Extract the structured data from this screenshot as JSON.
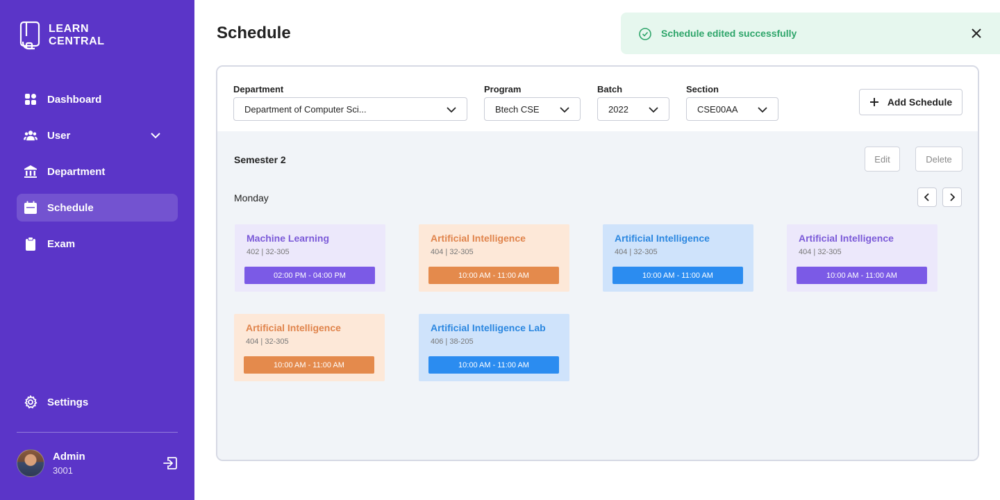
{
  "app": {
    "logo_line1": "LEARN",
    "logo_line2": "CENTRAL"
  },
  "sidebar": {
    "items": [
      {
        "label": "Dashboard",
        "icon": "grid-icon"
      },
      {
        "label": "User",
        "icon": "users-icon"
      },
      {
        "label": "Department",
        "icon": "bank-icon"
      },
      {
        "label": "Schedule",
        "icon": "calendar-icon",
        "active": true
      },
      {
        "label": "Exam",
        "icon": "clipboard-icon"
      }
    ],
    "settings_label": "Settings",
    "user_name": "Admin",
    "user_id": "3001"
  },
  "page": {
    "title": "Schedule"
  },
  "toast": {
    "message": "Schedule edited successfully"
  },
  "filters": {
    "department_label": "Department",
    "department_value": "Department of Computer Sci...",
    "program_label": "Program",
    "program_value": "Btech CSE",
    "batch_label": "Batch",
    "batch_value": "2022",
    "section_label": "Section",
    "section_value": "CSE00AA",
    "add_label": "Add Schedule"
  },
  "semester": {
    "label": "Semester 2",
    "edit_label": "Edit",
    "delete_label": "Delete",
    "day": "Monday"
  },
  "schedules": [
    {
      "title": "Machine Learning",
      "meta": "402 | 32-305",
      "time": "02:00 PM - 04:00 PM",
      "color": "purple"
    },
    {
      "title": "Artificial Intelligence",
      "meta": "404 | 32-305",
      "time": "10:00 AM - 11:00 AM",
      "color": "orange"
    },
    {
      "title": "Artificial Intelligence",
      "meta": "404 | 32-305",
      "time": "10:00 AM - 11:00 AM",
      "color": "blue"
    },
    {
      "title": "Artificial Intelligence",
      "meta": "404 | 32-305",
      "time": "10:00 AM - 11:00 AM",
      "color": "purple"
    },
    {
      "title": "Artificial Intelligence",
      "meta": "404 | 32-305",
      "time": "10:00 AM - 11:00 AM",
      "color": "orange"
    },
    {
      "title": "Artificial Intelligence Lab",
      "meta": "406 | 38-205",
      "time": "10:00 AM - 11:00 AM",
      "color": "blue"
    }
  ],
  "colors": {
    "sidebar_bg": "#5b35c8",
    "success": "#2ea56a",
    "purple": "#7b5ae6",
    "orange": "#e48a4c",
    "blue": "#2b8cf0"
  }
}
